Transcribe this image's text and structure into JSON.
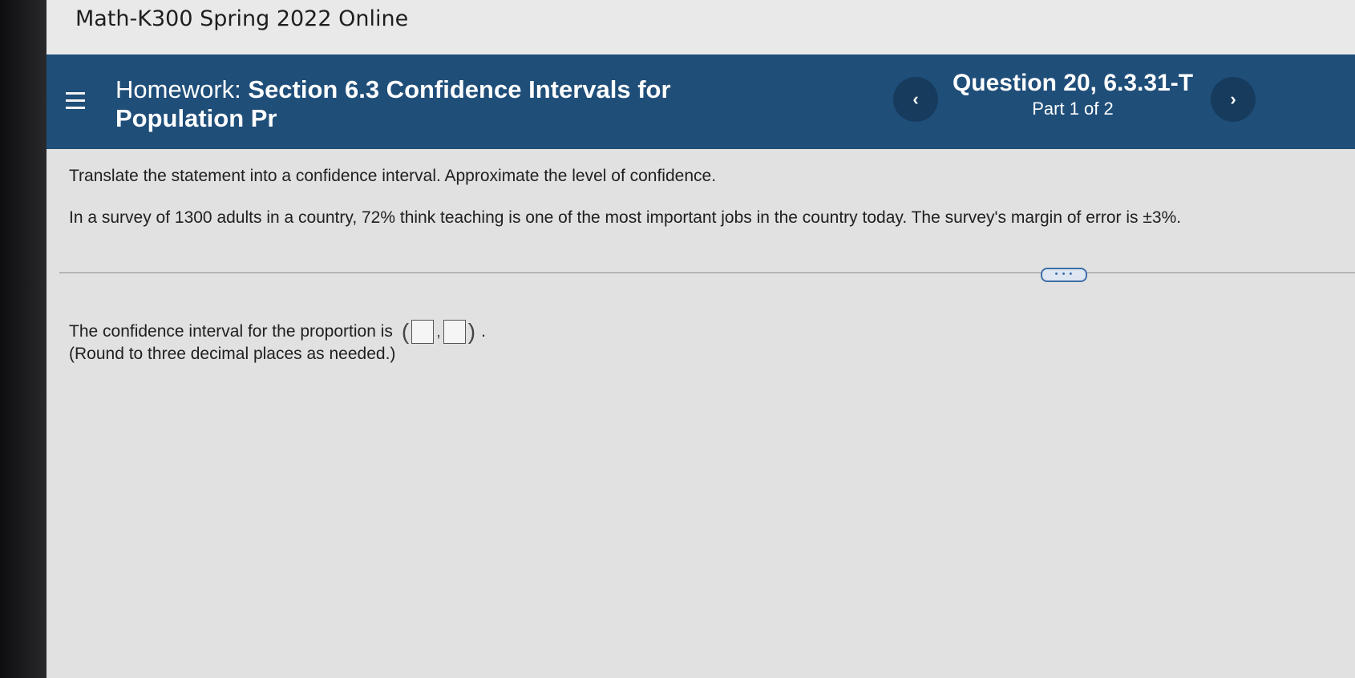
{
  "course": {
    "title": "Math-K300 Spring 2022 Online"
  },
  "header": {
    "homework_label": "Homework:",
    "homework_name": "Section 6.3 Confidence Intervals for Population Pr",
    "question_label": "Question 20, 6.3.31-T",
    "part_label": "Part 1 of 2",
    "prev_icon": "‹",
    "next_icon": "›",
    "menu_icon": "hamburger-menu-icon"
  },
  "problem": {
    "instructions": "Translate the statement into a confidence interval. Approximate the level of confidence.",
    "statement": "In a survey of 1300 adults in a country, 72% think teaching is one of the most important jobs in the country today. The survey's margin of error is ±3%.",
    "more_label": "• • •"
  },
  "answer": {
    "prompt": "The confidence interval for the proportion is",
    "open_paren": "(",
    "comma": ",",
    "close_paren": ")",
    "period": ".",
    "round_note": "(Round to three decimal places as needed.)",
    "lower_value": "",
    "upper_value": ""
  },
  "colors": {
    "header_bg": "#1f4e79",
    "nav_button_bg": "#163b5d",
    "content_bg": "#e1e1e1"
  }
}
